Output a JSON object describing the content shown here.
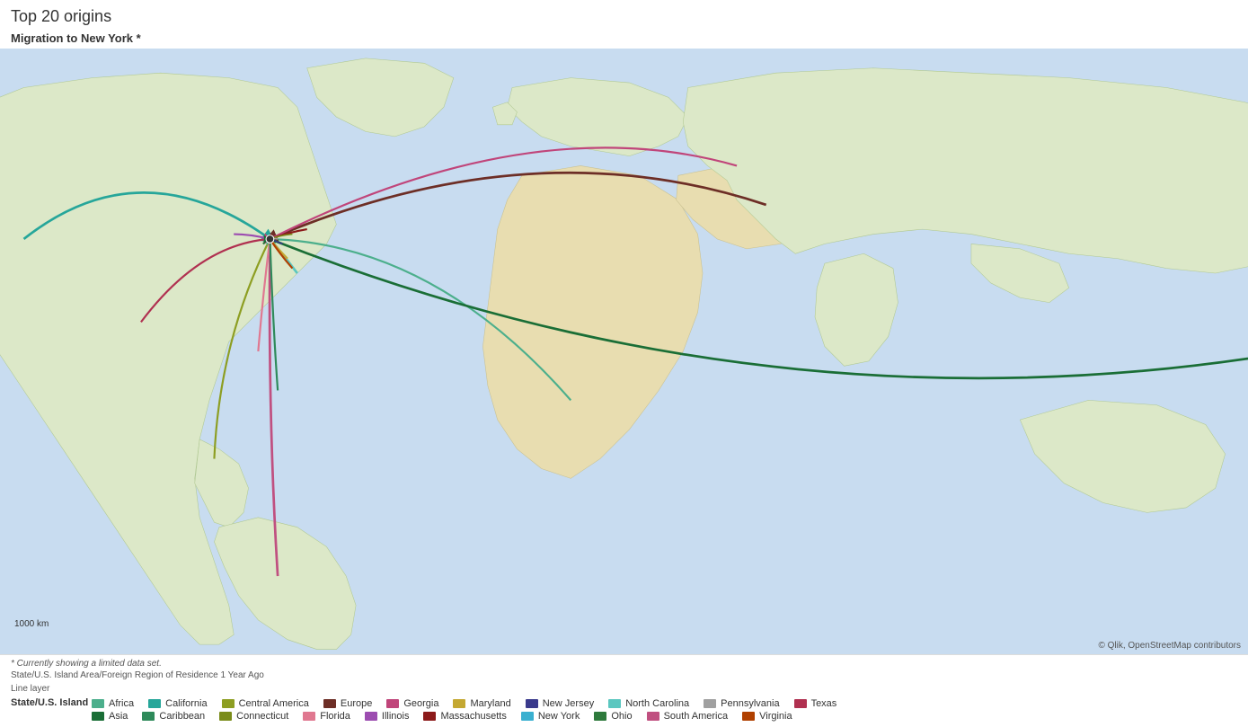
{
  "title": "Top 20 origins",
  "subtitle": "Migration to New York *",
  "footnote1": "* Currently showing a limited data set.",
  "footnote2": "State/U.S. Island Area/Foreign Region of Residence 1 Year Ago",
  "footnote3": "Line layer",
  "legend_header": "State/U.S. Island ...",
  "attribution": "© Qlik, OpenStreetMap contributors",
  "scale_label": "1000 km",
  "legend_row1": [
    {
      "label": "Africa",
      "color": "#4caf8c"
    },
    {
      "label": "California",
      "color": "#26a69a"
    },
    {
      "label": "Central America",
      "color": "#8d9e22"
    },
    {
      "label": "Europe",
      "color": "#6d2e26"
    },
    {
      "label": "Georgia",
      "color": "#c0457a"
    },
    {
      "label": "Maryland",
      "color": "#c4a832"
    },
    {
      "label": "New Jersey",
      "color": "#3a3a8c"
    },
    {
      "label": "North Carolina",
      "color": "#5bc7c0"
    },
    {
      "label": "Pennsylvania",
      "color": "#a0a0a0"
    },
    {
      "label": "Texas",
      "color": "#b03050"
    }
  ],
  "legend_row2": [
    {
      "label": "Asia",
      "color": "#1a6e36"
    },
    {
      "label": "Caribbean",
      "color": "#2e8a5a"
    },
    {
      "label": "Connecticut",
      "color": "#7a8c1a"
    },
    {
      "label": "Florida",
      "color": "#e07890"
    },
    {
      "label": "Illinois",
      "color": "#9c4cb0"
    },
    {
      "label": "Massachusetts",
      "color": "#8c1a1a"
    },
    {
      "label": "New York",
      "color": "#3ab0d0"
    },
    {
      "label": "Ohio",
      "color": "#2e7a3c"
    },
    {
      "label": "South America",
      "color": "#c05080"
    },
    {
      "label": "Virginia",
      "color": "#b04000"
    }
  ]
}
